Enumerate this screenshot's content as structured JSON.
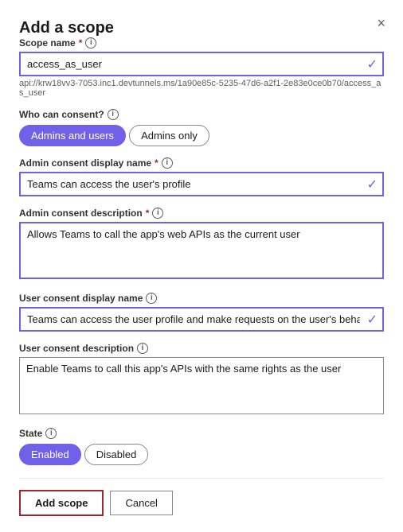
{
  "dialog": {
    "title": "Add a scope",
    "close_label": "×"
  },
  "fields": {
    "scope_name": {
      "label": "Scope name",
      "required": true,
      "value": "access_as_user",
      "api_url": "api://krw18vv3-7053.inc1.devtunnels.ms/1a90e85c-5235-47d6-a2f1-2e83e0ce0b70/access_as_user",
      "placeholder": ""
    },
    "who_can_consent": {
      "label": "Who can consent?",
      "options": [
        "Admins and users",
        "Admins only"
      ],
      "selected": "Admins and users"
    },
    "admin_consent_display_name": {
      "label": "Admin consent display name",
      "required": true,
      "value": "Teams can access the user's profile"
    },
    "admin_consent_description": {
      "label": "Admin consent description",
      "required": true,
      "value": "Allows Teams to call the app's web APIs as the current user"
    },
    "user_consent_display_name": {
      "label": "User consent display name",
      "value": "Teams can access the user profile and make requests on the user's behalf"
    },
    "user_consent_description": {
      "label": "User consent description",
      "value": "Enable Teams to call this app's APIs with the same rights as the user"
    },
    "state": {
      "label": "State",
      "options": [
        "Enabled",
        "Disabled"
      ],
      "selected": "Enabled"
    }
  },
  "actions": {
    "add_scope": "Add scope",
    "cancel": "Cancel"
  },
  "icons": {
    "info": "i",
    "check": "✓",
    "close": "✕"
  }
}
